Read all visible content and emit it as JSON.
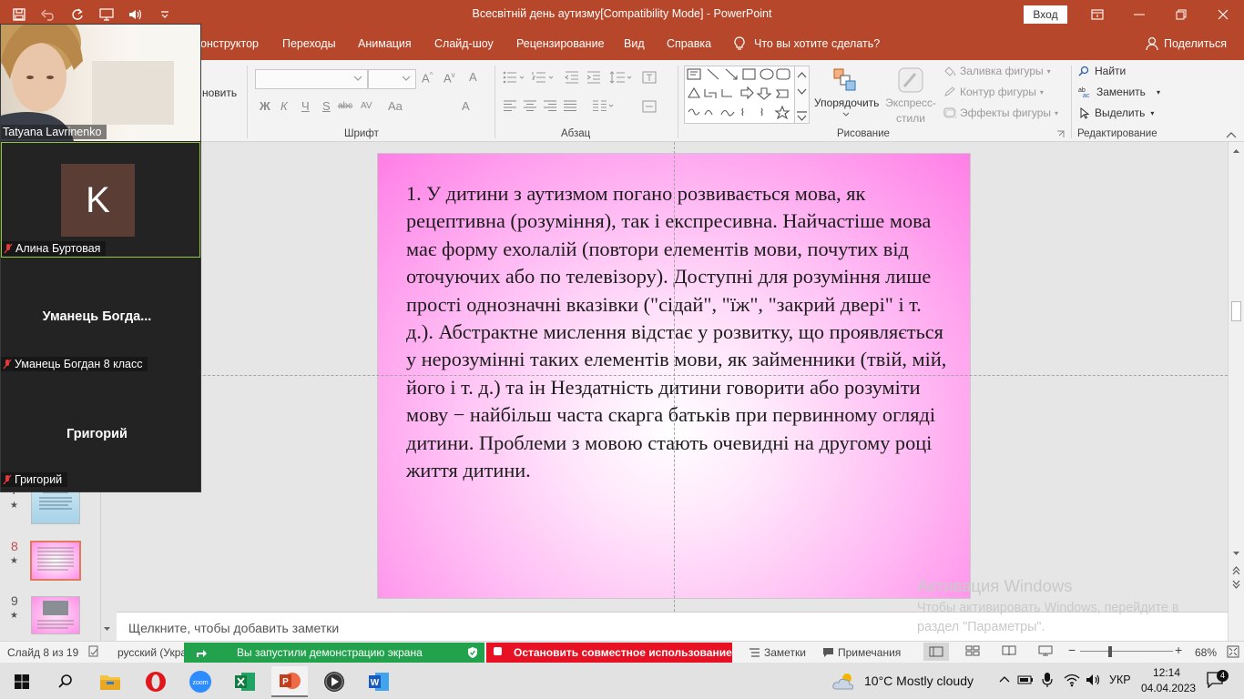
{
  "window": {
    "title": "Всесвітній день аутизму[Compatibility Mode]  -  PowerPoint",
    "signin_label": "Вход"
  },
  "tabs": [
    "онструктор",
    "Переходы",
    "Анимация",
    "Слайд-шоу",
    "Рецензирование",
    "Вид",
    "Справка"
  ],
  "search_prompt": "Что вы хотите сделать?",
  "share_label": "Поделиться",
  "ribbon": {
    "font_group": "Шрифт",
    "paragraph_group": "Абзац",
    "drawing_group": "Рисование",
    "editing_group": "Редактирование",
    "clipboard_partial": "новить",
    "arrange_label": "Упорядочить",
    "quick_styles_label_1": "Экспресс-",
    "quick_styles_label_2": "стили",
    "shape_fill": "Заливка фигуры",
    "shape_outline": "Контур фигуры",
    "shape_effects": "Эффекты фигуры",
    "find": "Найти",
    "replace": "Заменить",
    "select": "Выделить",
    "format_buttons": [
      "Ж",
      "К",
      "Ч",
      "S",
      "abc",
      "AV",
      "Aa",
      "A"
    ]
  },
  "slide": {
    "text": "1. У дитини з аутизмом погано розвивається мова, як рецептивна (розуміння), так і експресивна. Найчастіше мова має форму ехолалій (повтори елементів мови, почутих від оточуючих або по телевізору). Доступні для розуміння лише прості однозначні вказівки (\"сідай\", \"їж\", \"закрий двері\" і т. д.). Абстрактне мислення відстає у розвитку, що проявляється у нерозумінні таких елементів мови, як займенники (твій, мій, його і т. д.) та ін Нездатність дитини говорити або розуміти мову − найбільш часта скарга батьків при первинному огляді дитини. Проблеми з мовою стають очевидні на другому році життя дитини."
  },
  "notes_placeholder": "Щелкните, чтобы добавить заметки",
  "watermark": {
    "line1": "Активация Windows",
    "line2": "Чтобы активировать Windows, перейдите в",
    "line3": "раздел \"Параметры\"."
  },
  "thumbnails": [
    {
      "num": "7",
      "star": "★"
    },
    {
      "num": "8",
      "star": "★"
    },
    {
      "num": "9",
      "star": "★"
    }
  ],
  "statusbar": {
    "slide_counter": "Слайд 8 из 19",
    "language": "русский (Укра",
    "sharing_notice": "Вы запустили демонстрацию экрана",
    "stop_sharing": "Остановить совместное использование",
    "notes_btn": "Заметки",
    "comments_btn": "Примечания",
    "zoom": "68%"
  },
  "zoom_participants": [
    {
      "name": "Tatyana Lavrinenko"
    },
    {
      "name": "Алина Буртовая",
      "avatar_letter": "K"
    },
    {
      "display": "Уманець  Богда...",
      "name": "Уманець Богдан 8 класс"
    },
    {
      "display": "Григорий",
      "name": "Григорий"
    }
  ],
  "taskbar": {
    "weather": "10°C  Mostly cloudy",
    "lang": "УКР",
    "time": "12:14",
    "date": "04.04.2023",
    "notif_count": "4"
  },
  "colors": {
    "ppt_accent": "#b7472a",
    "share_green": "#23a24d",
    "share_red": "#e81123"
  }
}
